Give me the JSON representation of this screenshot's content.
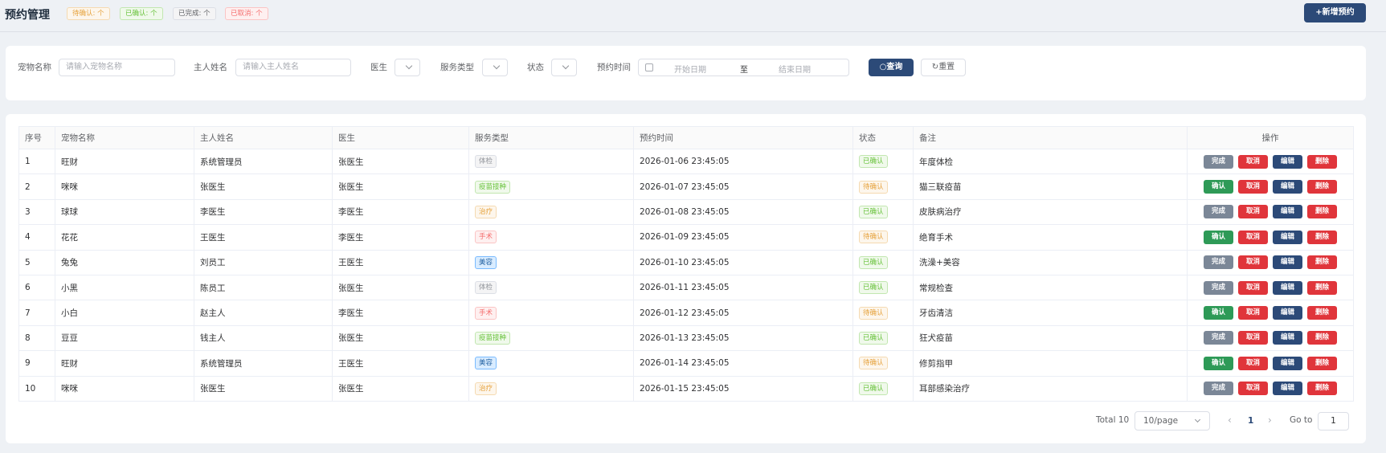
{
  "header": {
    "title": "预约管理",
    "stats": {
      "pending": "待确认: 个",
      "confirmed": "已确认: 个",
      "completed": "已完成: 个",
      "cancelled": "已取消: 个"
    },
    "add_button": "+新增预约"
  },
  "filters": {
    "pet_name_label": "宠物名称",
    "pet_name_placeholder": "请输入宠物名称",
    "owner_label": "主人姓名",
    "owner_placeholder": "请输入主人姓名",
    "doctor_label": "医生",
    "service_label": "服务类型",
    "status_label": "状态",
    "time_label": "预约时间",
    "start_placeholder": "开始日期",
    "range_separator": "至",
    "end_placeholder": "结束日期",
    "search_button": "查询",
    "reset_button": "重置"
  },
  "table": {
    "columns": [
      "序号",
      "宠物名称",
      "主人姓名",
      "医生",
      "服务类型",
      "预约时间",
      "状态",
      "备注",
      "操作"
    ],
    "rows": [
      {
        "no": "1",
        "pet": "旺财",
        "owner": "系统管理员",
        "doctor": "张医生",
        "service": "体检",
        "service_color": "gray",
        "time": "2026-01-06 23:45:05",
        "status": "已确认",
        "status_color": "green",
        "note": "年度体检",
        "primary_action": "完成",
        "primary_kind": "done"
      },
      {
        "no": "2",
        "pet": "咪咪",
        "owner": "张医生",
        "doctor": "张医生",
        "service": "疫苗接种",
        "service_color": "green",
        "time": "2026-01-07 23:45:05",
        "status": "待确认",
        "status_color": "orange",
        "note": "猫三联疫苗",
        "primary_action": "确认",
        "primary_kind": "confirm"
      },
      {
        "no": "3",
        "pet": "球球",
        "owner": "李医生",
        "doctor": "李医生",
        "service": "治疗",
        "service_color": "orange",
        "time": "2026-01-08 23:45:05",
        "status": "已确认",
        "status_color": "green",
        "note": "皮肤病治疗",
        "primary_action": "完成",
        "primary_kind": "done"
      },
      {
        "no": "4",
        "pet": "花花",
        "owner": "王医生",
        "doctor": "李医生",
        "service": "手术",
        "service_color": "red",
        "time": "2026-01-09 23:45:05",
        "status": "待确认",
        "status_color": "orange",
        "note": "绝育手术",
        "primary_action": "确认",
        "primary_kind": "confirm"
      },
      {
        "no": "5",
        "pet": "兔兔",
        "owner": "刘员工",
        "doctor": "王医生",
        "service": "美容",
        "service_color": "blue",
        "time": "2026-01-10 23:45:05",
        "status": "已确认",
        "status_color": "green",
        "note": "洗澡+美容",
        "primary_action": "完成",
        "primary_kind": "done"
      },
      {
        "no": "6",
        "pet": "小黑",
        "owner": "陈员工",
        "doctor": "张医生",
        "service": "体检",
        "service_color": "gray",
        "time": "2026-01-11 23:45:05",
        "status": "已确认",
        "status_color": "green",
        "note": "常规检查",
        "primary_action": "完成",
        "primary_kind": "done"
      },
      {
        "no": "7",
        "pet": "小白",
        "owner": "赵主人",
        "doctor": "李医生",
        "service": "手术",
        "service_color": "red",
        "time": "2026-01-12 23:45:05",
        "status": "待确认",
        "status_color": "orange",
        "note": "牙齿清洁",
        "primary_action": "确认",
        "primary_kind": "confirm"
      },
      {
        "no": "8",
        "pet": "豆豆",
        "owner": "钱主人",
        "doctor": "张医生",
        "service": "疫苗接种",
        "service_color": "green",
        "time": "2026-01-13 23:45:05",
        "status": "已确认",
        "status_color": "green",
        "note": "狂犬疫苗",
        "primary_action": "完成",
        "primary_kind": "done"
      },
      {
        "no": "9",
        "pet": "旺财",
        "owner": "系统管理员",
        "doctor": "王医生",
        "service": "美容",
        "service_color": "blue",
        "time": "2026-01-14 23:45:05",
        "status": "待确认",
        "status_color": "orange",
        "note": "修剪指甲",
        "primary_action": "确认",
        "primary_kind": "confirm"
      },
      {
        "no": "10",
        "pet": "咪咪",
        "owner": "张医生",
        "doctor": "张医生",
        "service": "治疗",
        "service_color": "orange",
        "time": "2026-01-15 23:45:05",
        "status": "已确认",
        "status_color": "green",
        "note": "耳部感染治疗",
        "primary_action": "完成",
        "primary_kind": "done"
      }
    ],
    "action_labels": {
      "cancel": "取消",
      "edit": "编辑",
      "delete": "删除"
    }
  },
  "pagination": {
    "total": "Total 10",
    "page_size": "10/page",
    "current_page": "1",
    "goto_label": "Go to",
    "goto_value": "1"
  },
  "colors": {
    "primary": "#2c4a78",
    "danger": "#e0353b",
    "success": "#2e9a57",
    "neutral": "#7b8797"
  }
}
